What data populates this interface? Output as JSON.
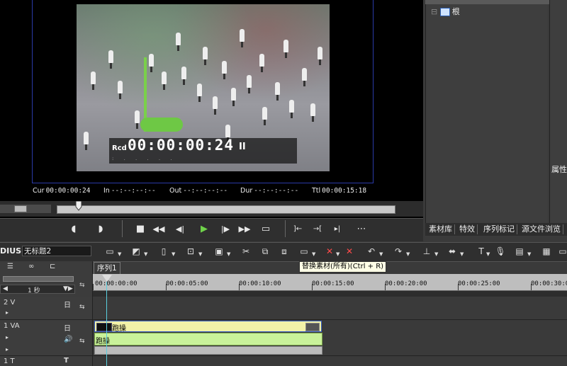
{
  "player": {
    "rcd_label": "Rcd",
    "rcd_timecode": "00:00:00:24",
    "rcd_state": "II",
    "rcd_dots": ":  .  .  .  .  .",
    "timecodes": {
      "cur_label": "Cur",
      "cur": "00:00:00:24",
      "in_label": "In",
      "in": "--:--:--:--",
      "out_label": "Out",
      "out": "--:--:--:--",
      "dur_label": "Dur",
      "dur": "--:--:--:--",
      "ttl_label": "Ttl",
      "ttl": "00:00:15:18"
    },
    "controls": {
      "set_in": "◖",
      "set_out": "◗",
      "stop": "■",
      "rewind": "◀◀",
      "step_back": "◀|",
      "play": "▶",
      "step_forward": "|▶",
      "fast_forward": "▶▶",
      "loop": "▭",
      "insert": "]←",
      "overwrite": "→[",
      "match": "▸|",
      "more": "⋯"
    }
  },
  "library": {
    "tree_root": "根"
  },
  "properties": {
    "label": "属性"
  },
  "panel_tabs": [
    "素材库",
    "特效",
    "序列标记",
    "源文件浏览"
  ],
  "toolbar": {
    "app_name": "DIUS",
    "project_name": "无标题2",
    "tooltip": "替换素材(所有)(Ctrl + R)"
  },
  "timeline": {
    "sequence_tab": "序列1",
    "scale": "1 秒",
    "ruler_labels": [
      "00:00:00:00",
      "00:00:05:00",
      "00:00:10:00",
      "00:00:15:00",
      "00:00:20:00",
      "00:00:25:00",
      "00:00:30:0"
    ],
    "tracks": [
      {
        "name": "2 V",
        "icon": "日"
      },
      {
        "name": "1 VA",
        "icon": "日"
      },
      {
        "name": "1 T",
        "icon": "T"
      }
    ],
    "clip_video_name": "跑操",
    "clip_audio_name": "跑操"
  },
  "colors": {
    "play_green": "#6fd34a",
    "clip_video": "#f2f2a8",
    "clip_audio": "#c9f29a",
    "frame_border": "#2a3aa8"
  }
}
